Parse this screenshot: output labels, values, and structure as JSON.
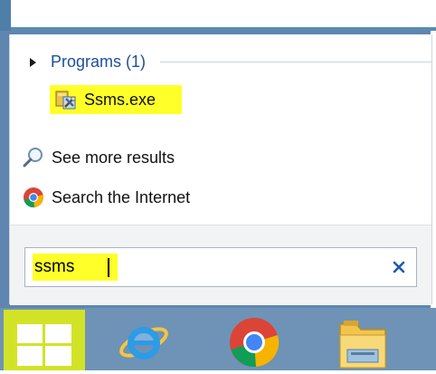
{
  "colors": {
    "accent_blue": "#1e4f9c",
    "highlight_yellow": "#ffff2a",
    "panel_blue": "#5e86b0",
    "taskbar_blue": "#6e93b6",
    "start_button_green": "#d2e327"
  },
  "results": {
    "programs_header": "Programs (1)",
    "programs": [
      {
        "name": "Ssms.exe",
        "icon": "ssms-app-icon"
      }
    ],
    "see_more": {
      "label": "See more results",
      "icon": "magnifier-icon"
    },
    "search_internet": {
      "label": "Search the Internet",
      "icon": "chrome-icon"
    }
  },
  "search": {
    "value": "ssms",
    "clear_icon": "clear-x-icon"
  },
  "taskbar": {
    "items": [
      {
        "name": "start",
        "icon": "windows-logo-icon"
      },
      {
        "name": "internet-explorer",
        "icon": "internet-explorer-icon"
      },
      {
        "name": "chrome",
        "icon": "chrome-icon"
      },
      {
        "name": "file-explorer",
        "icon": "folder-icon"
      }
    ]
  }
}
